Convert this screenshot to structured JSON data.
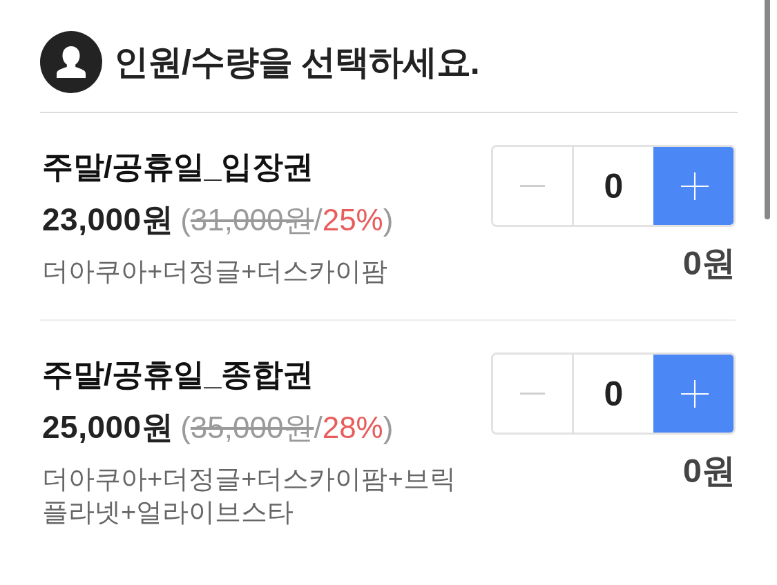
{
  "header": {
    "title": "인원/수량을 선택하세요."
  },
  "tickets": [
    {
      "name": "주말/공휴일_입장권",
      "price": "23,000원",
      "price_note": [
        {
          "kind": "plain",
          "text": "("
        },
        {
          "kind": "struck",
          "text": "31,000원"
        },
        {
          "kind": "plain",
          "text": "/"
        },
        {
          "kind": "discount",
          "text": "25%"
        },
        {
          "kind": "plain",
          "text": ")"
        }
      ],
      "description": "더아쿠아+더정글+더스카이팜",
      "decrease_disabled": true,
      "quantity": "0",
      "total": "0원"
    },
    {
      "name": "주말/공휴일_종합권",
      "price": "25,000원",
      "price_note": [
        {
          "kind": "plain",
          "text": "("
        },
        {
          "kind": "struck",
          "text": "35,000원"
        },
        {
          "kind": "plain",
          "text": "/"
        },
        {
          "kind": "discount",
          "text": "28%"
        },
        {
          "kind": "plain",
          "text": ")"
        }
      ],
      "description": "더아쿠아+더정글+더스카이팜+브릭플라넷+얼라이브스타",
      "decrease_disabled": true,
      "quantity": "0",
      "total": "0원"
    }
  ]
}
